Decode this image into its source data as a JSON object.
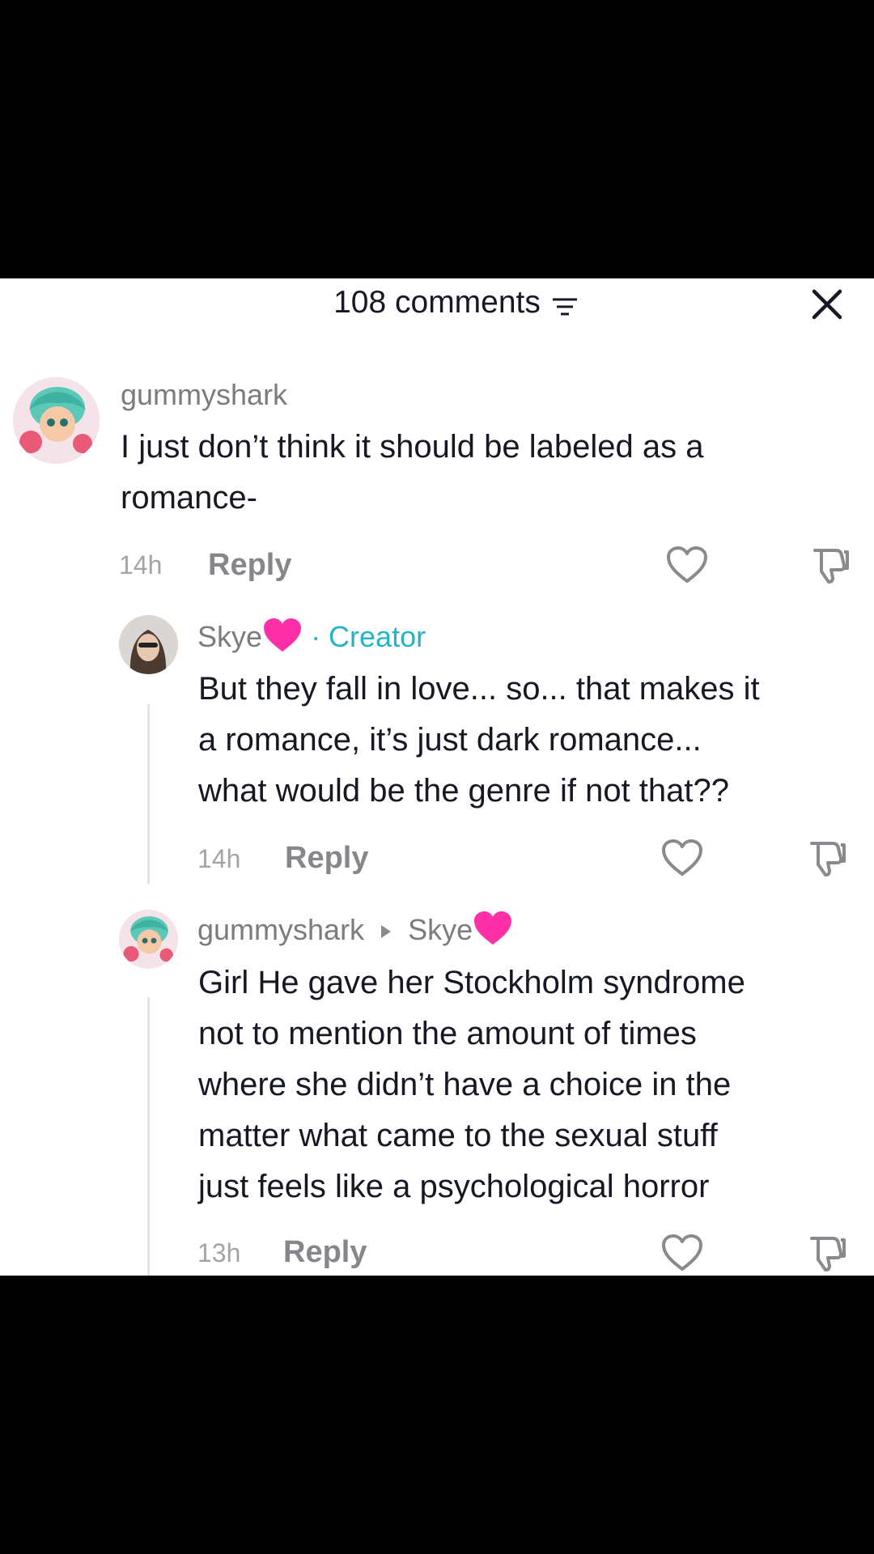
{
  "header": {
    "comment_count": "108 comments"
  },
  "icons": {
    "sort": "sort-lines-icon",
    "close": "close-icon",
    "like": "heart-outline-icon",
    "dislike": "thumbs-down-icon",
    "emoji": "pink-heart-emoji"
  },
  "colors": {
    "creator_badge": "#26b3c6",
    "heart_emoji": "#ff2fa8"
  },
  "comments": [
    {
      "username": "gummyshark",
      "text_lines": [
        "I just don’t think it should be labeled as a",
        "romance-"
      ],
      "time": "14h",
      "reply_label": "Reply"
    },
    {
      "username": "Skye",
      "badge": "· Creator",
      "text_lines": [
        "But they fall in love... so... that makes it",
        "a romance, it’s just dark romance...",
        "what would be the genre if not that??"
      ],
      "time": "14h",
      "reply_label": "Reply"
    },
    {
      "username": "gummyshark",
      "reply_to": "Skye",
      "text_lines": [
        "Girl He gave her Stockholm syndrome",
        "not to mention the amount of times",
        "where she didn’t have a choice in the",
        "matter what came to the sexual stuff",
        "just feels like a psychological horror"
      ],
      "time": "13h",
      "reply_label": "Reply"
    }
  ]
}
